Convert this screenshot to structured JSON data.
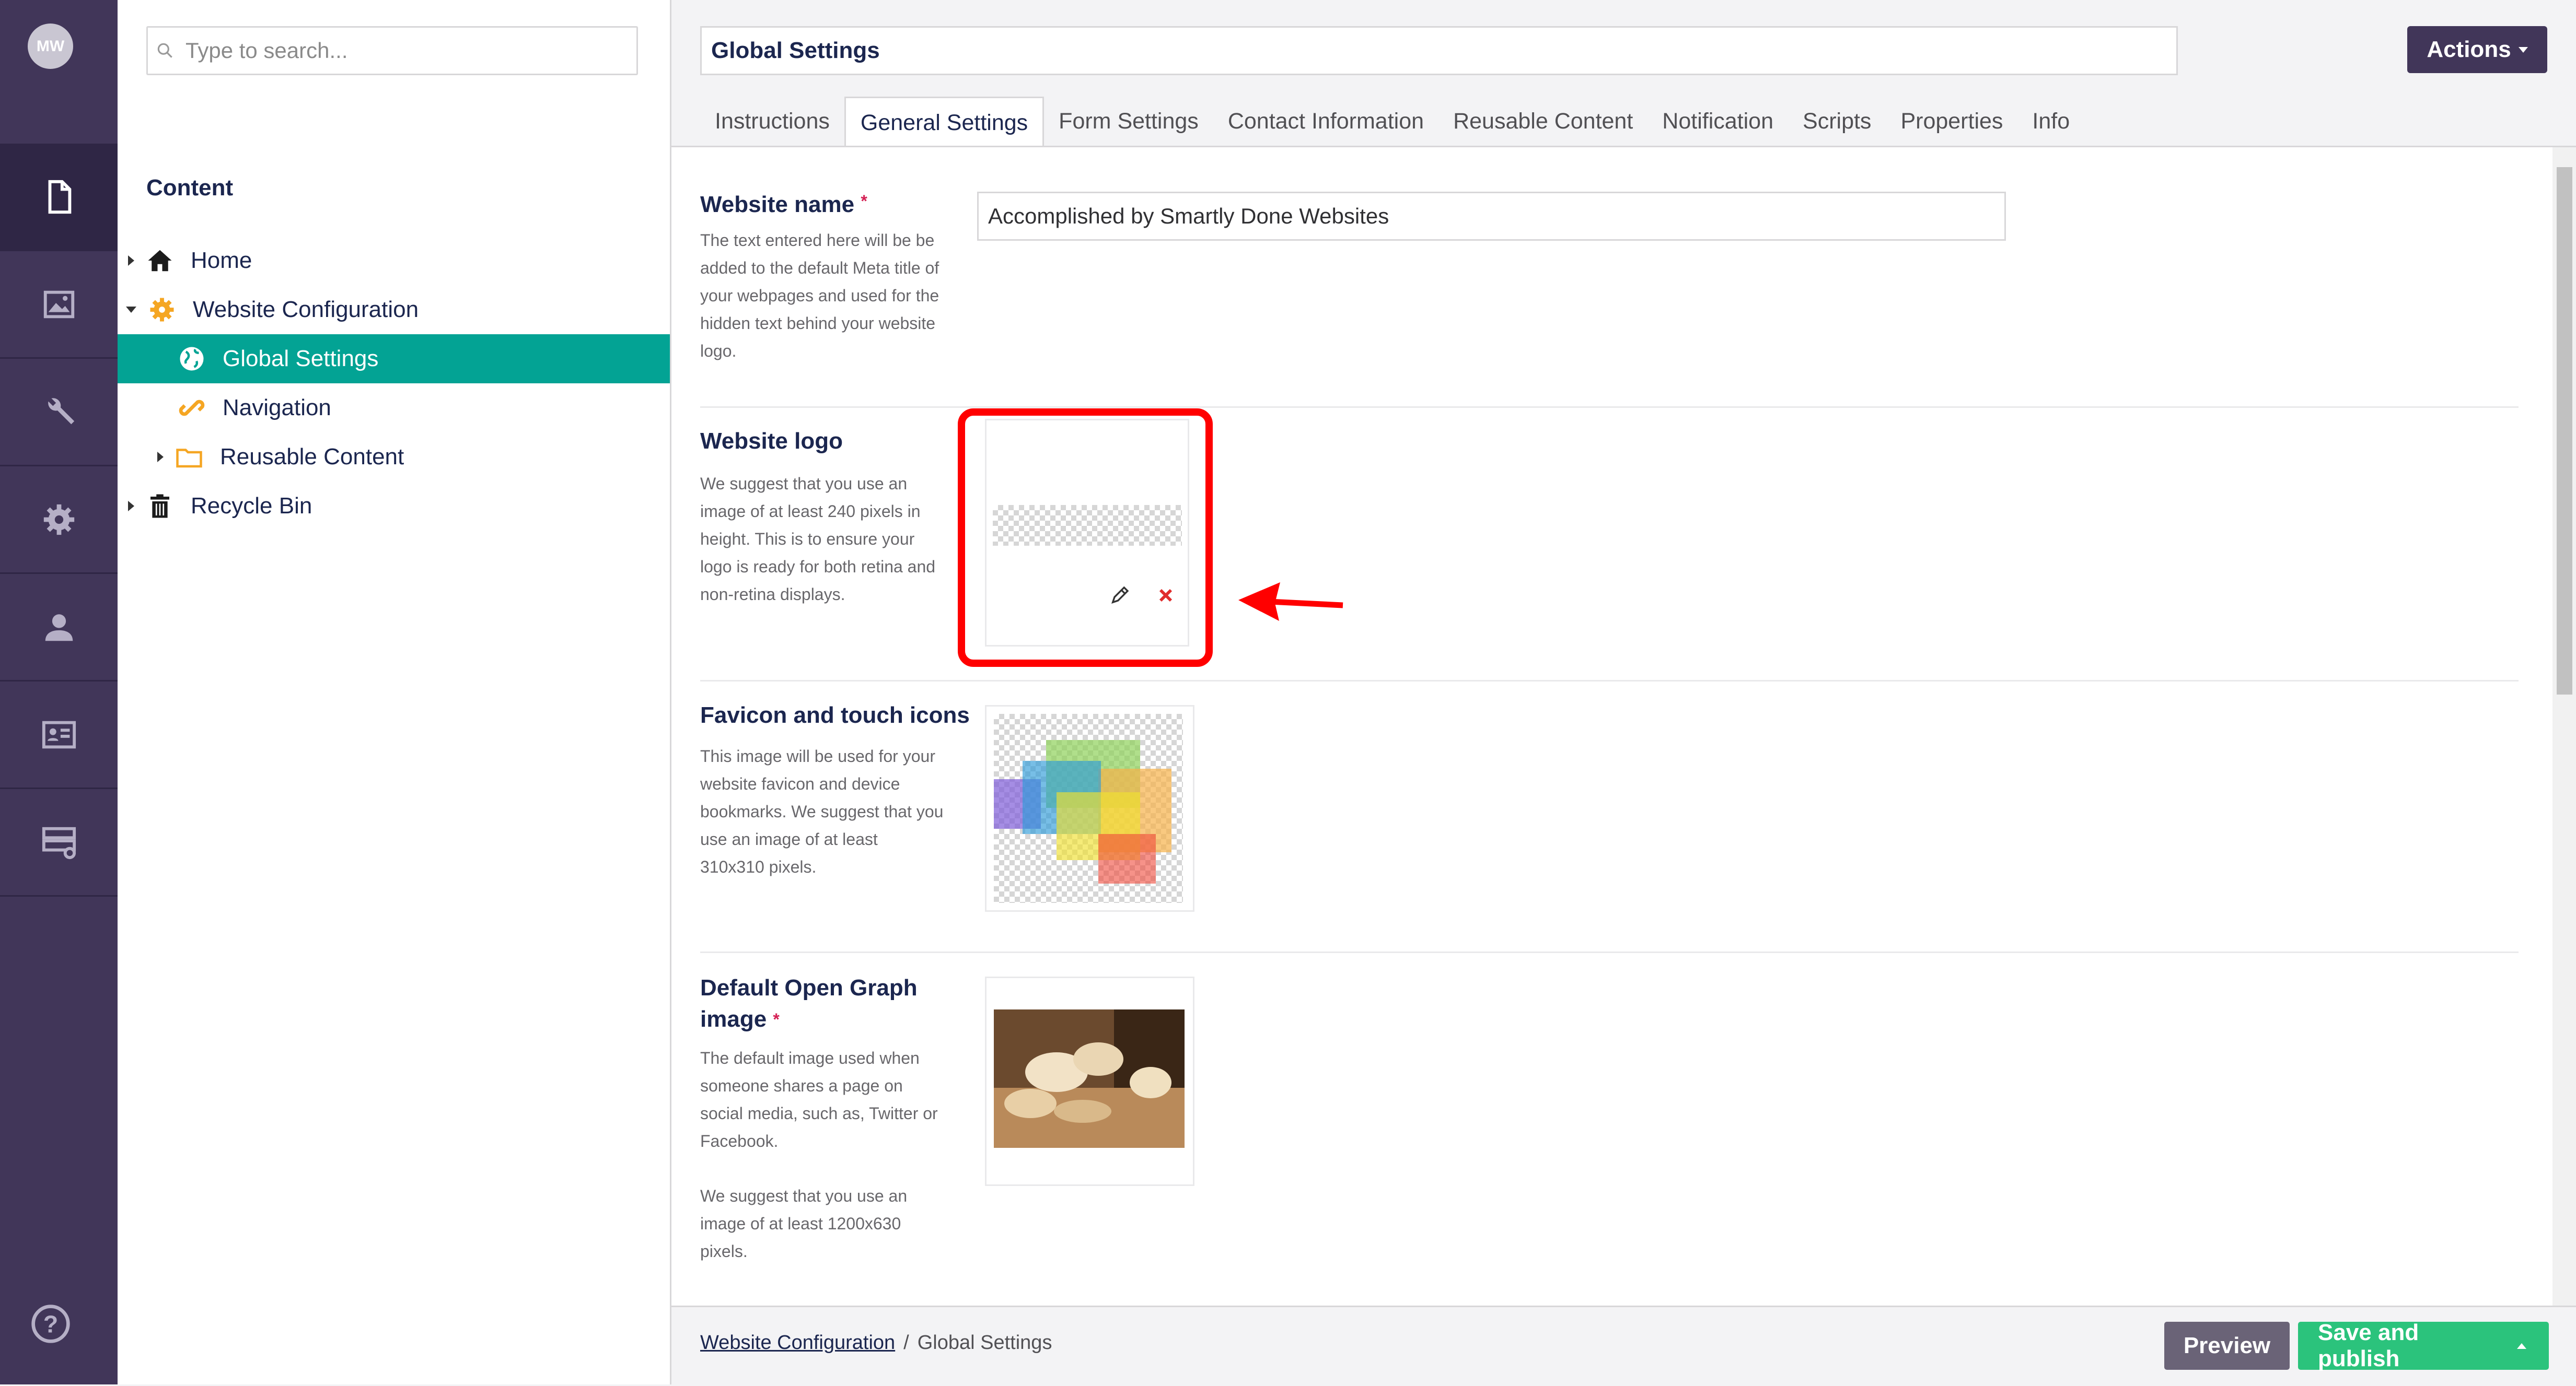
{
  "user": {
    "initials": "MW"
  },
  "rail": {
    "items": [
      {
        "icon": "document-icon",
        "label": "Content",
        "active": true
      },
      {
        "icon": "image-icon",
        "label": "Media"
      },
      {
        "icon": "wrench-icon",
        "label": "Settings"
      },
      {
        "icon": "gear-icon",
        "label": "Packages"
      },
      {
        "icon": "user-icon",
        "label": "Users"
      },
      {
        "icon": "contact-card-icon",
        "label": "Members"
      },
      {
        "icon": "forms-icon",
        "label": "Forms"
      }
    ],
    "help_icon": "help-icon"
  },
  "tree": {
    "search_placeholder": "Type to search...",
    "section_title": "Content",
    "items": [
      {
        "label": "Home",
        "icon": "home-icon",
        "caret": "right"
      },
      {
        "label": "Website Configuration",
        "icon": "gear-icon",
        "caret": "down"
      },
      {
        "label": "Global Settings",
        "icon": "globe-icon",
        "selected": true
      },
      {
        "label": "Navigation",
        "icon": "link-icon"
      },
      {
        "label": "Reusable Content",
        "icon": "folder-icon",
        "caret": "right"
      },
      {
        "label": "Recycle Bin",
        "icon": "trash-icon",
        "caret": "right"
      }
    ]
  },
  "header": {
    "title": "Global Settings",
    "actions_label": "Actions",
    "tabs": [
      "Instructions",
      "General Settings",
      "Form Settings",
      "Contact Information",
      "Reusable Content",
      "Notification",
      "Scripts",
      "Properties",
      "Info"
    ],
    "active_tab": "General Settings"
  },
  "fields": {
    "website_name": {
      "label": "Website name",
      "required": "*",
      "description": "The text entered here will be be added to the default Meta title of your webpages and used for the hidden text behind your website logo.",
      "value": "Accomplished by Smartly Done Websites"
    },
    "website_logo": {
      "label": "Website logo",
      "description": "We suggest that you use an image of at least 240 pixels in height. This is to ensure your logo is ready for both retina and non-retina displays."
    },
    "favicon": {
      "label": "Favicon and touch icons",
      "description": "This image will be used for your website favicon and device bookmarks. We suggest that you use an image of at least 310x310 pixels."
    },
    "og_image": {
      "label": "Default Open Graph image",
      "required": "*",
      "description": "The default image used when someone shares a page on social media, such as, Twitter or Facebook.",
      "description2": "We suggest that you use an image of at least 1200x630 pixels."
    }
  },
  "footer": {
    "breadcrumb_parent": "Website Configuration",
    "breadcrumb_separator": "/",
    "breadcrumb_current": "Global Settings",
    "preview_label": "Preview",
    "publish_label": "Save and publish"
  },
  "colors": {
    "rail_bg": "#413659",
    "selected_bg": "#03a394",
    "publish_green": "#2bc37c",
    "annotation_red": "#ff0000"
  }
}
